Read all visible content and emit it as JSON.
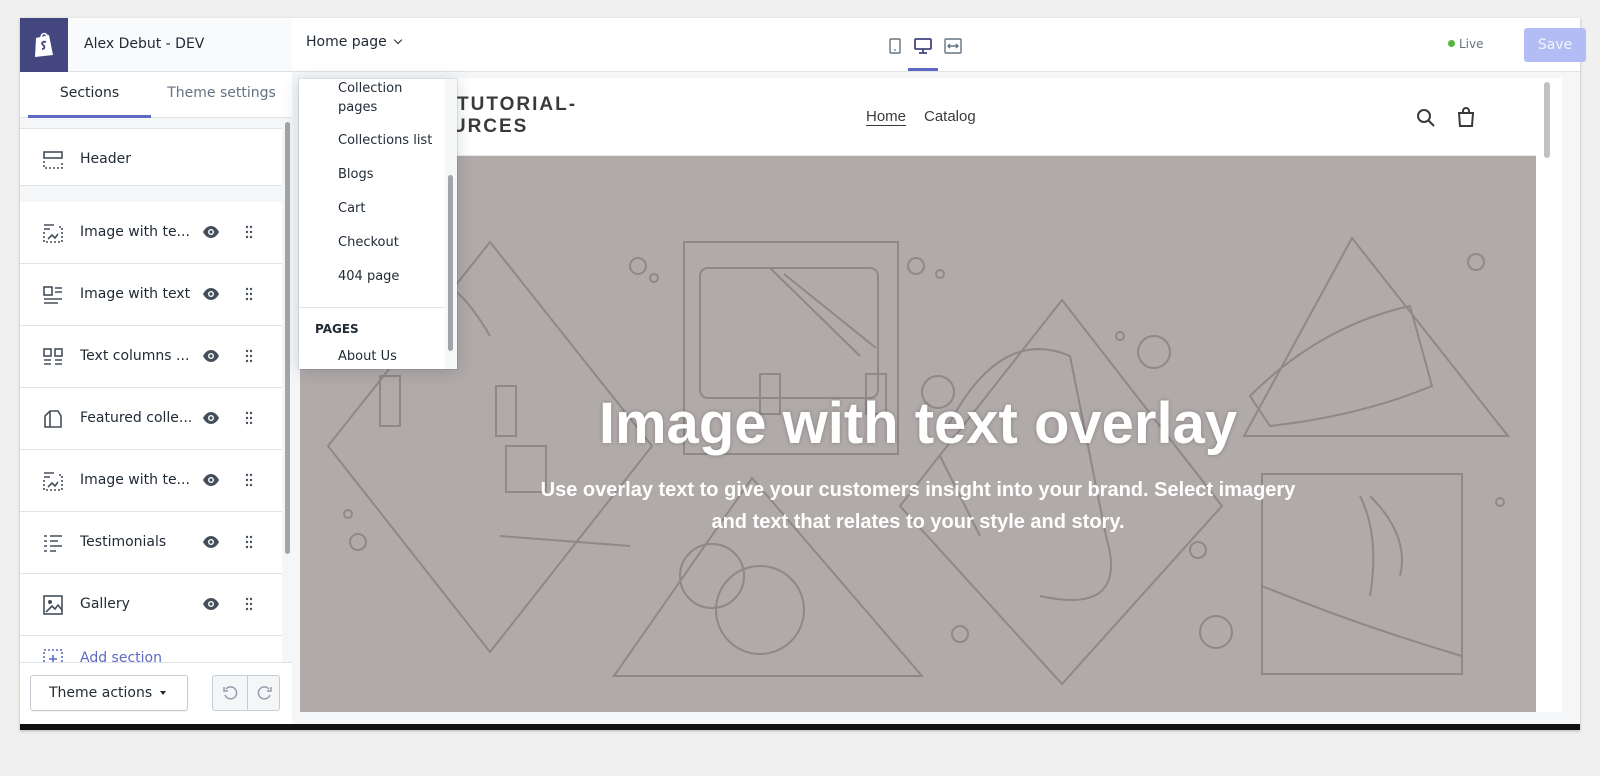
{
  "store": {
    "name": "Alex Debut - DEV"
  },
  "sidebar": {
    "tabs": [
      {
        "label": "Sections",
        "active": true
      },
      {
        "label": "Theme settings",
        "active": false
      }
    ],
    "header_section": {
      "label": "Header",
      "icon": "header-icon"
    },
    "sections": [
      {
        "label": "Image with te...",
        "icon": "image-text-overlay-icon"
      },
      {
        "label": "Image with text",
        "icon": "image-text-icon"
      },
      {
        "label": "Text columns ...",
        "icon": "text-columns-icon"
      },
      {
        "label": "Featured colle...",
        "icon": "featured-collection-icon"
      },
      {
        "label": "Image with te...",
        "icon": "image-text-overlay-icon"
      },
      {
        "label": "Testimonials",
        "icon": "testimonials-icon"
      },
      {
        "label": "Gallery",
        "icon": "gallery-icon"
      }
    ],
    "add_section_label": "Add section",
    "theme_actions_label": "Theme actions"
  },
  "topbar": {
    "page_select_label": "Home page",
    "live_label": "Live",
    "save_label": "Save",
    "active_device": "desktop"
  },
  "dropdown": {
    "items": [
      "Collection pages",
      "Collections list",
      "Blogs",
      "Cart",
      "Checkout",
      "404 page"
    ],
    "group_heading": "PAGES",
    "group_items": [
      "About Us"
    ]
  },
  "preview": {
    "brand": "ALEX-TUTORIAL-RESOURCES",
    "nav": [
      "Home",
      "Catalog"
    ],
    "hero_title": "Image with text overlay",
    "hero_subtitle": "Use overlay text to give your customers insight into your brand. Select imagery and text that relates to your style and story.",
    "colors": {
      "hero_bg": "#b0aaa9",
      "accent": "#5c6ac4",
      "live_dot": "#50b83c",
      "logo_bg": "#43467f"
    }
  }
}
